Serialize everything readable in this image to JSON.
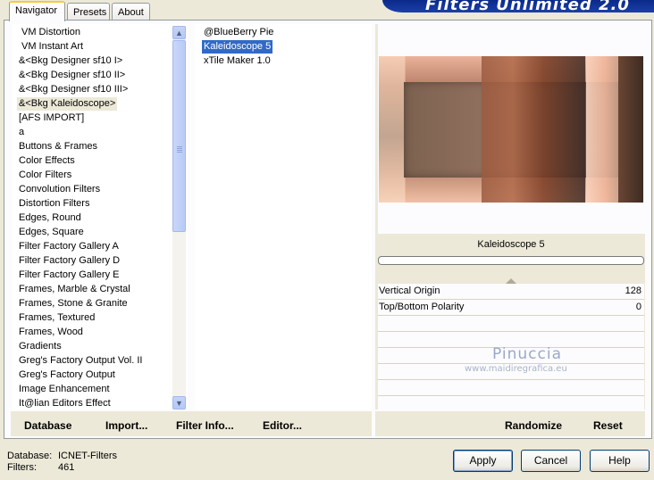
{
  "banner": {
    "title": "Filters Unlimited 2.0"
  },
  "tabs": [
    {
      "label": "Navigator",
      "active": true
    },
    {
      "label": "Presets",
      "active": false
    },
    {
      "label": "About",
      "active": false
    }
  ],
  "categories": [
    "VM Distortion",
    "VM Instant Art",
    "&<Bkg Designer sf10 I>",
    "&<Bkg Designer sf10 II>",
    "&<Bkg Designer sf10 III>",
    "&<Bkg Kaleidoscope>",
    "[AFS IMPORT]",
    "a",
    "Buttons & Frames",
    "Color Effects",
    "Color Filters",
    "Convolution Filters",
    "Distortion Filters",
    "Edges, Round",
    "Edges, Square",
    "Filter Factory Gallery A",
    "Filter Factory Gallery D",
    "Filter Factory Gallery E",
    "Frames, Marble & Crystal",
    "Frames, Stone & Granite",
    "Frames, Textured",
    "Frames, Wood",
    "Gradients",
    "Greg's Factory Output Vol. II",
    "Greg's Factory Output",
    "Image Enhancement",
    "It@lian Editors Effect"
  ],
  "selected_category": "&<Bkg Kaleidoscope>",
  "filters": [
    "@BlueBerry Pie",
    "Kaleidoscope 5",
    "xTile Maker 1.0"
  ],
  "selected_filter": "Kaleidoscope 5",
  "preview": {
    "filter_name": "Kaleidoscope 5",
    "progress": 0
  },
  "params": [
    {
      "label": "Vertical Origin",
      "value": "128"
    },
    {
      "label": "Top/Bottom Polarity",
      "value": "0"
    }
  ],
  "watermark": {
    "name": "Pinuccia",
    "url": "www.maidiregrafica.eu"
  },
  "links": {
    "database": "Database",
    "import": "Import...",
    "filter_info": "Filter Info...",
    "editor": "Editor...",
    "randomize": "Randomize",
    "reset": "Reset"
  },
  "footer": {
    "database_label": "Database:",
    "database_value": "ICNET-Filters",
    "filters_label": "Filters:",
    "filters_value": "461"
  },
  "buttons": {
    "apply": "Apply",
    "cancel": "Cancel",
    "help": "Help"
  },
  "icons": {
    "scroll_up": "chevron-up-icon",
    "scroll_down": "chevron-down-icon"
  },
  "colors": {
    "selection": "#316ac5",
    "banner": "#0a2a8a",
    "tab_highlight": "#ffc83c"
  }
}
